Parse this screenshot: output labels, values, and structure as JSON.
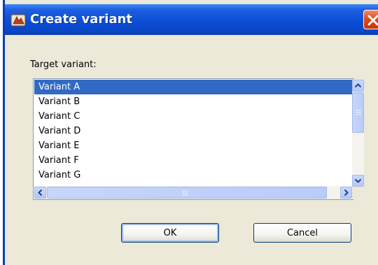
{
  "dialog": {
    "title": "Create variant",
    "title_icon": "variant-app-icon",
    "close_icon": "close-icon"
  },
  "form": {
    "label": "Target variant:",
    "options": [
      "Variant A",
      "Variant B",
      "Variant C",
      "Variant D",
      "Variant E",
      "Variant F",
      "Variant G"
    ],
    "selected_index": 0
  },
  "buttons": {
    "ok": "OK",
    "cancel": "Cancel"
  },
  "colors": {
    "titlebar": "#0b4ed8",
    "selection": "#316ac5",
    "dialog_bg": "#ece9d8",
    "close": "#e04a1c"
  }
}
